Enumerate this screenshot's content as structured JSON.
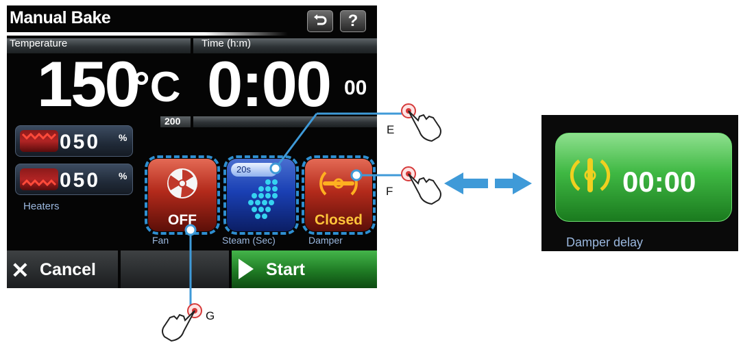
{
  "screen": {
    "title": "Manual Bake",
    "back_icon": "back-arrow-icon",
    "help_label": "?",
    "temperature": {
      "label": "Temperature",
      "value": "150",
      "unit": "°C",
      "setpoint": "200"
    },
    "time": {
      "label": "Time (h:m)",
      "value": "0:00",
      "seconds": "00"
    },
    "heaters": {
      "label": "Heaters",
      "top_value": "050",
      "bottom_value": "050",
      "unit": "%"
    },
    "tiles": {
      "fan": {
        "state": "OFF",
        "label": "Fan",
        "icon": "fan-icon"
      },
      "steam": {
        "time": "20s",
        "label": "Steam (Sec)",
        "icon": "steam-drops-icon"
      },
      "damper": {
        "state": "Closed",
        "label": "Damper",
        "icon": "damper-valve-icon"
      }
    },
    "buttons": {
      "cancel": "Cancel",
      "start": "Start"
    }
  },
  "callouts": {
    "e": "E",
    "f": "F",
    "g": "G"
  },
  "damper_delay": {
    "value": "00:00",
    "label": "Damper delay"
  },
  "colors": {
    "callout_dash": "#2f8fd1",
    "arrow": "#3f9ad8",
    "fan_tile": "#b32a1b",
    "steam_tile": "#1a40b4",
    "start_button": "#1f7b24",
    "damper_state_text": "#ffc53a"
  }
}
